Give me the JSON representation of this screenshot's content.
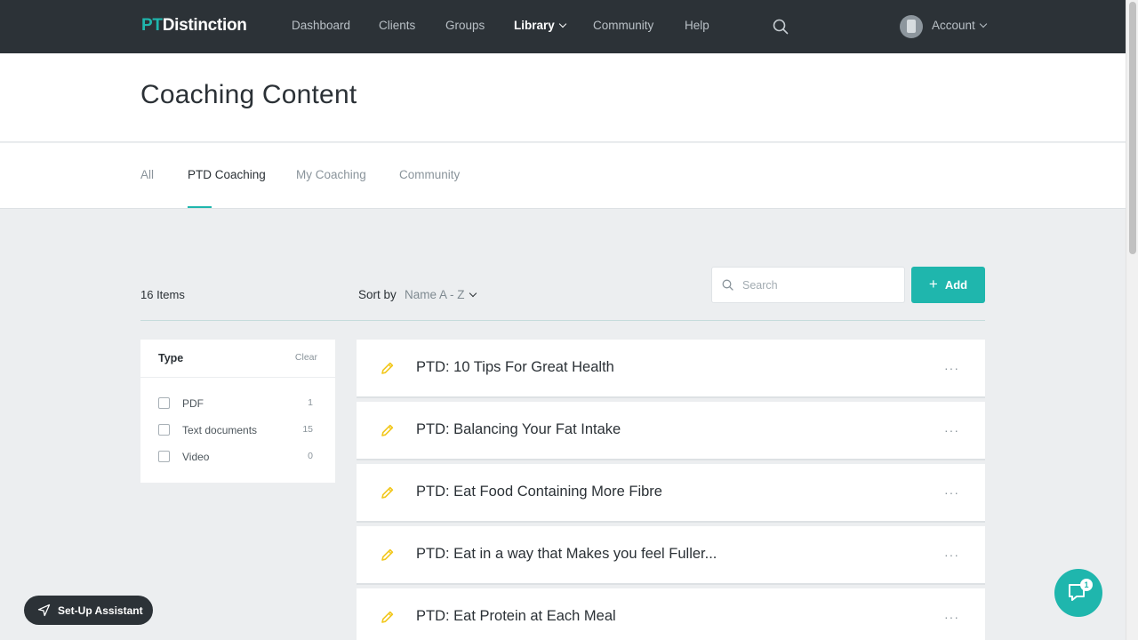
{
  "logo": {
    "part1": "PT",
    "part2": "Distinction"
  },
  "nav": {
    "links": [
      {
        "label": "Dashboard"
      },
      {
        "label": "Clients"
      },
      {
        "label": "Groups"
      },
      {
        "label": "Library"
      },
      {
        "label": "Community"
      },
      {
        "label": "Help"
      }
    ],
    "active": "Library",
    "account_label": "Account"
  },
  "page": {
    "title": "Coaching Content"
  },
  "tabs": [
    {
      "label": "All"
    },
    {
      "label": "PTD Coaching"
    },
    {
      "label": "My Coaching"
    },
    {
      "label": "Community"
    }
  ],
  "active_tab": "PTD Coaching",
  "toolbar": {
    "items_count": "16 Items",
    "sort_label": "Sort by",
    "sort_value": "Name A - Z",
    "search_placeholder": "Search",
    "add_label": "Add"
  },
  "filter": {
    "title": "Type",
    "clear_label": "Clear",
    "options": [
      {
        "label": "PDF",
        "count": "1"
      },
      {
        "label": "Text documents",
        "count": "15"
      },
      {
        "label": "Video",
        "count": "0"
      }
    ]
  },
  "items": [
    {
      "title": "PTD: 10 Tips For Great Health"
    },
    {
      "title": "PTD: Balancing Your Fat Intake"
    },
    {
      "title": "PTD: Eat Food Containing More Fibre"
    },
    {
      "title": "PTD: Eat in a way that Makes you feel Fuller..."
    },
    {
      "title": "PTD: Eat Protein at Each Meal"
    }
  ],
  "more_glyph": "···",
  "assistant": {
    "label": "Set-Up Assistant"
  },
  "chat": {
    "badge": "1"
  },
  "colors": {
    "accent": "#1fb6ad",
    "nav_bg": "#2c3237",
    "pencil": "#f2c71b"
  },
  "icons": [
    "search-icon",
    "chevron-down-icon",
    "plus-icon",
    "pencil-icon",
    "more-icon",
    "navigation-arrow-icon",
    "chat-icon"
  ]
}
